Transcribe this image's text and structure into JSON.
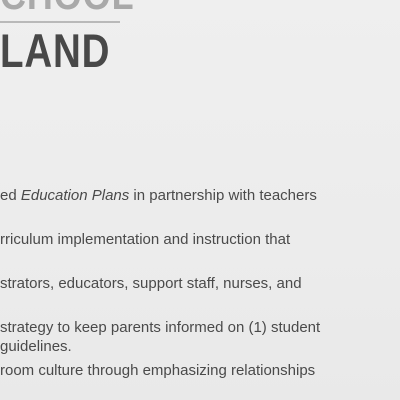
{
  "header": {
    "top_fragment": "CHOOL",
    "title_fragment": "LAND"
  },
  "content": {
    "line_1_prefix": "ed ",
    "line_1_italic": "Education Plans",
    "line_1_suffix": " in partnership with teachers",
    "line_2": "rriculum implementation and instruction that",
    "line_3": "strators, educators, support staff, nurses, and",
    "line_4": " strategy to keep parents informed on (1) student",
    "line_5": "guidelines.",
    "line_6": "room culture through emphasizing relationships"
  }
}
